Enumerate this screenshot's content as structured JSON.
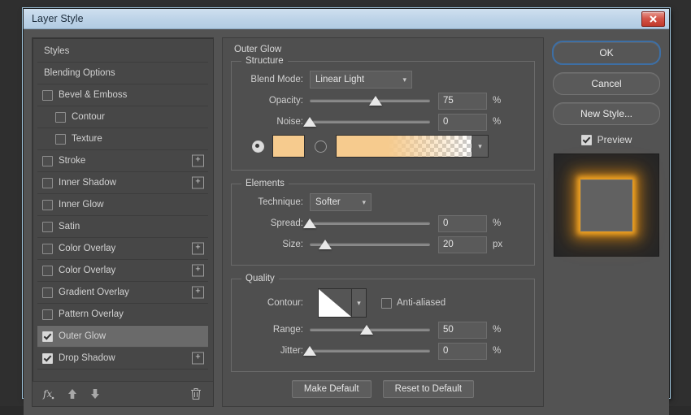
{
  "window": {
    "title": "Layer Style",
    "close_icon": "close-icon"
  },
  "styles_panel": {
    "items": [
      {
        "label": "Styles",
        "type": "header",
        "checkbox": null,
        "plus": false,
        "selected": false,
        "indent": false
      },
      {
        "label": "Blending Options",
        "type": "header",
        "checkbox": null,
        "plus": false,
        "selected": false,
        "indent": false
      },
      {
        "label": "Bevel & Emboss",
        "type": "effect",
        "checkbox": false,
        "plus": false,
        "selected": false,
        "indent": false
      },
      {
        "label": "Contour",
        "type": "sub",
        "checkbox": false,
        "plus": false,
        "selected": false,
        "indent": true
      },
      {
        "label": "Texture",
        "type": "sub",
        "checkbox": false,
        "plus": false,
        "selected": false,
        "indent": true
      },
      {
        "label": "Stroke",
        "type": "effect",
        "checkbox": false,
        "plus": true,
        "selected": false,
        "indent": false
      },
      {
        "label": "Inner Shadow",
        "type": "effect",
        "checkbox": false,
        "plus": true,
        "selected": false,
        "indent": false
      },
      {
        "label": "Inner Glow",
        "type": "effect",
        "checkbox": false,
        "plus": false,
        "selected": false,
        "indent": false
      },
      {
        "label": "Satin",
        "type": "effect",
        "checkbox": false,
        "plus": false,
        "selected": false,
        "indent": false
      },
      {
        "label": "Color Overlay",
        "type": "effect",
        "checkbox": false,
        "plus": true,
        "selected": false,
        "indent": false
      },
      {
        "label": "Color Overlay",
        "type": "effect",
        "checkbox": false,
        "plus": true,
        "selected": false,
        "indent": false
      },
      {
        "label": "Gradient Overlay",
        "type": "effect",
        "checkbox": false,
        "plus": true,
        "selected": false,
        "indent": false
      },
      {
        "label": "Pattern Overlay",
        "type": "effect",
        "checkbox": false,
        "plus": false,
        "selected": false,
        "indent": false
      },
      {
        "label": "Outer Glow",
        "type": "effect",
        "checkbox": true,
        "plus": false,
        "selected": true,
        "indent": false
      },
      {
        "label": "Drop Shadow",
        "type": "effect",
        "checkbox": true,
        "plus": true,
        "selected": false,
        "indent": false
      }
    ],
    "toolbar": {
      "fx_icon": "fx-icon",
      "up_icon": "arrow-up-icon",
      "down_icon": "arrow-down-icon",
      "trash_icon": "trash-icon"
    }
  },
  "settings": {
    "effect_title": "Outer Glow",
    "structure": {
      "legend": "Structure",
      "blend_mode_label": "Blend Mode:",
      "blend_mode_value": "Linear Light",
      "opacity_label": "Opacity:",
      "opacity_value": "75",
      "opacity_unit": "%",
      "opacity_percent": 55,
      "noise_label": "Noise:",
      "noise_value": "0",
      "noise_unit": "%",
      "noise_percent": 0,
      "fill_type": "color",
      "color_swatch": "#f6cb8e",
      "gradient_from": "#f6cb8e",
      "gradient_to": "transparent"
    },
    "elements": {
      "legend": "Elements",
      "technique_label": "Technique:",
      "technique_value": "Softer",
      "spread_label": "Spread:",
      "spread_value": "0",
      "spread_unit": "%",
      "spread_percent": 0,
      "size_label": "Size:",
      "size_value": "20",
      "size_unit": "px",
      "size_percent": 13
    },
    "quality": {
      "legend": "Quality",
      "contour_label": "Contour:",
      "anti_aliased_label": "Anti-aliased",
      "anti_aliased_checked": false,
      "range_label": "Range:",
      "range_value": "50",
      "range_unit": "%",
      "range_percent": 47,
      "jitter_label": "Jitter:",
      "jitter_value": "0",
      "jitter_unit": "%",
      "jitter_percent": 0
    },
    "make_default_label": "Make Default",
    "reset_default_label": "Reset to Default"
  },
  "actions": {
    "ok_label": "OK",
    "cancel_label": "Cancel",
    "new_style_label": "New Style...",
    "preview_label": "Preview",
    "preview_checked": true,
    "glow_color": "#f5a623"
  }
}
